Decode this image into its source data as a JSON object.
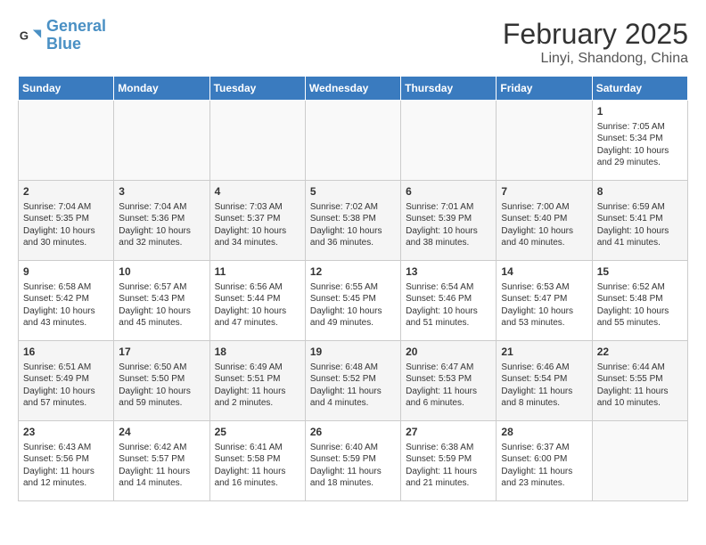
{
  "logo": {
    "line1": "General",
    "line2": "Blue"
  },
  "title": "February 2025",
  "subtitle": "Linyi, Shandong, China",
  "weekdays": [
    "Sunday",
    "Monday",
    "Tuesday",
    "Wednesday",
    "Thursday",
    "Friday",
    "Saturday"
  ],
  "weeks": [
    [
      {
        "day": "",
        "content": ""
      },
      {
        "day": "",
        "content": ""
      },
      {
        "day": "",
        "content": ""
      },
      {
        "day": "",
        "content": ""
      },
      {
        "day": "",
        "content": ""
      },
      {
        "day": "",
        "content": ""
      },
      {
        "day": "1",
        "content": "Sunrise: 7:05 AM\nSunset: 5:34 PM\nDaylight: 10 hours and 29 minutes."
      }
    ],
    [
      {
        "day": "2",
        "content": "Sunrise: 7:04 AM\nSunset: 5:35 PM\nDaylight: 10 hours and 30 minutes."
      },
      {
        "day": "3",
        "content": "Sunrise: 7:04 AM\nSunset: 5:36 PM\nDaylight: 10 hours and 32 minutes."
      },
      {
        "day": "4",
        "content": "Sunrise: 7:03 AM\nSunset: 5:37 PM\nDaylight: 10 hours and 34 minutes."
      },
      {
        "day": "5",
        "content": "Sunrise: 7:02 AM\nSunset: 5:38 PM\nDaylight: 10 hours and 36 minutes."
      },
      {
        "day": "6",
        "content": "Sunrise: 7:01 AM\nSunset: 5:39 PM\nDaylight: 10 hours and 38 minutes."
      },
      {
        "day": "7",
        "content": "Sunrise: 7:00 AM\nSunset: 5:40 PM\nDaylight: 10 hours and 40 minutes."
      },
      {
        "day": "8",
        "content": "Sunrise: 6:59 AM\nSunset: 5:41 PM\nDaylight: 10 hours and 41 minutes."
      }
    ],
    [
      {
        "day": "9",
        "content": "Sunrise: 6:58 AM\nSunset: 5:42 PM\nDaylight: 10 hours and 43 minutes."
      },
      {
        "day": "10",
        "content": "Sunrise: 6:57 AM\nSunset: 5:43 PM\nDaylight: 10 hours and 45 minutes."
      },
      {
        "day": "11",
        "content": "Sunrise: 6:56 AM\nSunset: 5:44 PM\nDaylight: 10 hours and 47 minutes."
      },
      {
        "day": "12",
        "content": "Sunrise: 6:55 AM\nSunset: 5:45 PM\nDaylight: 10 hours and 49 minutes."
      },
      {
        "day": "13",
        "content": "Sunrise: 6:54 AM\nSunset: 5:46 PM\nDaylight: 10 hours and 51 minutes."
      },
      {
        "day": "14",
        "content": "Sunrise: 6:53 AM\nSunset: 5:47 PM\nDaylight: 10 hours and 53 minutes."
      },
      {
        "day": "15",
        "content": "Sunrise: 6:52 AM\nSunset: 5:48 PM\nDaylight: 10 hours and 55 minutes."
      }
    ],
    [
      {
        "day": "16",
        "content": "Sunrise: 6:51 AM\nSunset: 5:49 PM\nDaylight: 10 hours and 57 minutes."
      },
      {
        "day": "17",
        "content": "Sunrise: 6:50 AM\nSunset: 5:50 PM\nDaylight: 10 hours and 59 minutes."
      },
      {
        "day": "18",
        "content": "Sunrise: 6:49 AM\nSunset: 5:51 PM\nDaylight: 11 hours and 2 minutes."
      },
      {
        "day": "19",
        "content": "Sunrise: 6:48 AM\nSunset: 5:52 PM\nDaylight: 11 hours and 4 minutes."
      },
      {
        "day": "20",
        "content": "Sunrise: 6:47 AM\nSunset: 5:53 PM\nDaylight: 11 hours and 6 minutes."
      },
      {
        "day": "21",
        "content": "Sunrise: 6:46 AM\nSunset: 5:54 PM\nDaylight: 11 hours and 8 minutes."
      },
      {
        "day": "22",
        "content": "Sunrise: 6:44 AM\nSunset: 5:55 PM\nDaylight: 11 hours and 10 minutes."
      }
    ],
    [
      {
        "day": "23",
        "content": "Sunrise: 6:43 AM\nSunset: 5:56 PM\nDaylight: 11 hours and 12 minutes."
      },
      {
        "day": "24",
        "content": "Sunrise: 6:42 AM\nSunset: 5:57 PM\nDaylight: 11 hours and 14 minutes."
      },
      {
        "day": "25",
        "content": "Sunrise: 6:41 AM\nSunset: 5:58 PM\nDaylight: 11 hours and 16 minutes."
      },
      {
        "day": "26",
        "content": "Sunrise: 6:40 AM\nSunset: 5:59 PM\nDaylight: 11 hours and 18 minutes."
      },
      {
        "day": "27",
        "content": "Sunrise: 6:38 AM\nSunset: 5:59 PM\nDaylight: 11 hours and 21 minutes."
      },
      {
        "day": "28",
        "content": "Sunrise: 6:37 AM\nSunset: 6:00 PM\nDaylight: 11 hours and 23 minutes."
      },
      {
        "day": "",
        "content": ""
      }
    ]
  ]
}
